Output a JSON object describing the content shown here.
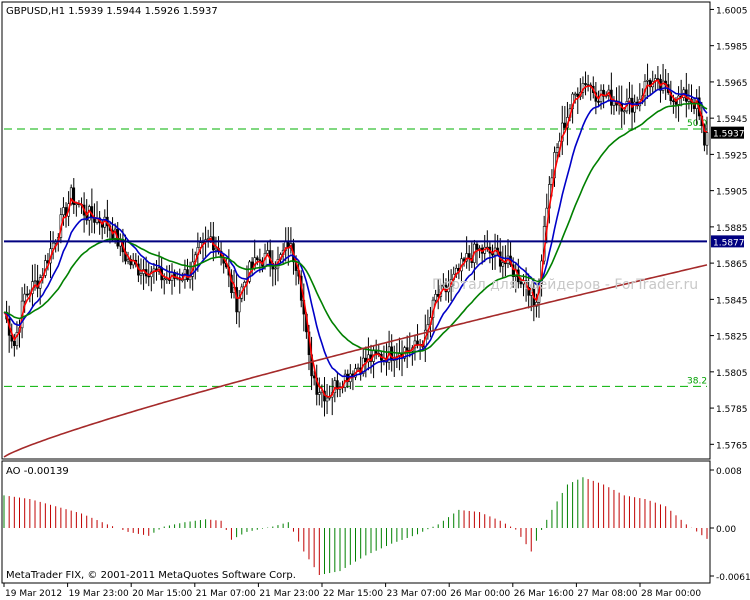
{
  "chart_data": [
    {
      "type": "candlestick",
      "symbol_label": "GBPUSD,H1  1.5939 1.5944 1.5926 1.5937",
      "ylim": [
        1.5758,
        1.6008
      ],
      "y_ticks": [
        "1.6005",
        "1.5985",
        "1.5965",
        "1.5945",
        "1.5925",
        "1.5905",
        "1.5885",
        "1.5865",
        "1.5845",
        "1.5825",
        "1.5805",
        "1.5785",
        "1.5765"
      ],
      "current_price": "1.5937",
      "level_line_price": "1.5877",
      "fib_levels": [
        {
          "label": "50.0",
          "price": 1.5939
        },
        {
          "label": "38.2",
          "price": 1.5797
        }
      ],
      "x_labels": [
        "19 Mar 2012",
        "19 Mar 23:00",
        "20 Mar 15:00",
        "21 Mar 07:00",
        "21 Mar 23:00",
        "22 Mar 15:00",
        "23 Mar 07:00",
        "26 Mar 00:00",
        "26 Mar 16:00",
        "27 Mar 08:00",
        "28 Mar 00:00"
      ],
      "series": [
        {
          "name": "MA fast",
          "color": "#ff0000"
        },
        {
          "name": "MA medium",
          "color": "#0000c8"
        },
        {
          "name": "MA slow",
          "color": "#008000"
        },
        {
          "name": "MA very slow",
          "color": "#a52a2a"
        }
      ],
      "watermark": "Портал для трейдеров - ForTrader.ru",
      "price_path": [
        [
          0,
          1.5838
        ],
        [
          4,
          1.582
        ],
        [
          8,
          1.5847
        ],
        [
          14,
          1.5857
        ],
        [
          20,
          1.588
        ],
        [
          26,
          1.5902
        ],
        [
          32,
          1.5892
        ],
        [
          40,
          1.5887
        ],
        [
          44,
          1.5877
        ],
        [
          48,
          1.5866
        ],
        [
          52,
          1.5862
        ],
        [
          56,
          1.5862
        ],
        [
          60,
          1.5858
        ],
        [
          64,
          1.5856
        ],
        [
          68,
          1.5858
        ],
        [
          72,
          1.586
        ],
        [
          76,
          1.5872
        ],
        [
          80,
          1.5879
        ],
        [
          84,
          1.5871
        ],
        [
          88,
          1.5851
        ],
        [
          90,
          1.5843
        ],
        [
          94,
          1.5859
        ],
        [
          98,
          1.5866
        ],
        [
          102,
          1.5868
        ],
        [
          106,
          1.5865
        ],
        [
          110,
          1.5876
        ],
        [
          114,
          1.5862
        ],
        [
          118,
          1.5811
        ],
        [
          121,
          1.5797
        ],
        [
          125,
          1.5792
        ],
        [
          129,
          1.5799
        ],
        [
          135,
          1.5806
        ],
        [
          141,
          1.5812
        ],
        [
          147,
          1.5814
        ],
        [
          153,
          1.5817
        ],
        [
          159,
          1.5818
        ],
        [
          163,
          1.5824
        ],
        [
          167,
          1.5846
        ],
        [
          171,
          1.585
        ],
        [
          175,
          1.5858
        ],
        [
          179,
          1.5867
        ],
        [
          183,
          1.5872
        ],
        [
          187,
          1.5871
        ],
        [
          191,
          1.5869
        ],
        [
          195,
          1.5864
        ],
        [
          199,
          1.5858
        ],
        [
          203,
          1.5852
        ],
        [
          205,
          1.5841
        ],
        [
          207,
          1.5855
        ],
        [
          210,
          1.5898
        ],
        [
          213,
          1.5922
        ],
        [
          216,
          1.5939
        ],
        [
          219,
          1.5951
        ],
        [
          222,
          1.5961
        ],
        [
          225,
          1.5966
        ],
        [
          229,
          1.5959
        ],
        [
          233,
          1.5957
        ],
        [
          237,
          1.5955
        ],
        [
          241,
          1.5952
        ],
        [
          245,
          1.5954
        ],
        [
          249,
          1.5966
        ],
        [
          253,
          1.5962
        ],
        [
          257,
          1.596
        ],
        [
          261,
          1.5955
        ],
        [
          265,
          1.5957
        ],
        [
          268,
          1.5952
        ],
        [
          270,
          1.5938
        ],
        [
          271,
          1.5928
        ],
        [
          272,
          1.5937
        ]
      ]
    },
    {
      "type": "histogram",
      "indicator_label": "AO -0.00139",
      "ylim": [
        -0.0008,
        0.008
      ],
      "y_ticks": [
        "0.008",
        "0.00",
        "-0.00617"
      ],
      "x_labels": [
        "19 Mar 2012",
        "19 Mar 23:00",
        "20 Mar 15:00",
        "21 Mar 07:00",
        "21 Mar 23:00",
        "22 Mar 15:00",
        "23 Mar 07:00",
        "26 Mar 00:00",
        "26 Mar 16:00",
        "27 Mar 08:00",
        "28 Mar 00:00"
      ],
      "values_path": [
        [
          0,
          0.0045
        ],
        [
          10,
          0.004
        ],
        [
          20,
          0.003
        ],
        [
          30,
          0.002
        ],
        [
          40,
          0.0005
        ],
        [
          48,
          -0.0005
        ],
        [
          56,
          -0.001
        ],
        [
          62,
          0.0002
        ],
        [
          70,
          0.0008
        ],
        [
          78,
          0.0012
        ],
        [
          84,
          0.001
        ],
        [
          88,
          -0.0015
        ],
        [
          94,
          -0.0005
        ],
        [
          104,
          0.0002
        ],
        [
          110,
          0.0008
        ],
        [
          116,
          -0.003
        ],
        [
          122,
          -0.006
        ],
        [
          130,
          -0.0055
        ],
        [
          140,
          -0.0035
        ],
        [
          150,
          -0.002
        ],
        [
          160,
          -0.0008
        ],
        [
          168,
          0.0005
        ],
        [
          176,
          0.0025
        ],
        [
          184,
          0.0022
        ],
        [
          192,
          0.001
        ],
        [
          198,
          -0.0002
        ],
        [
          204,
          -0.003
        ],
        [
          212,
          0.0025
        ],
        [
          218,
          0.006
        ],
        [
          224,
          0.007
        ],
        [
          232,
          0.006
        ],
        [
          240,
          0.0045
        ],
        [
          248,
          0.004
        ],
        [
          256,
          0.003
        ],
        [
          264,
          0.0005
        ],
        [
          272,
          -0.00139
        ]
      ]
    }
  ],
  "footer_text": "MetaTrader FIX, © 2001-2011 MetaQuotes Software Corp."
}
